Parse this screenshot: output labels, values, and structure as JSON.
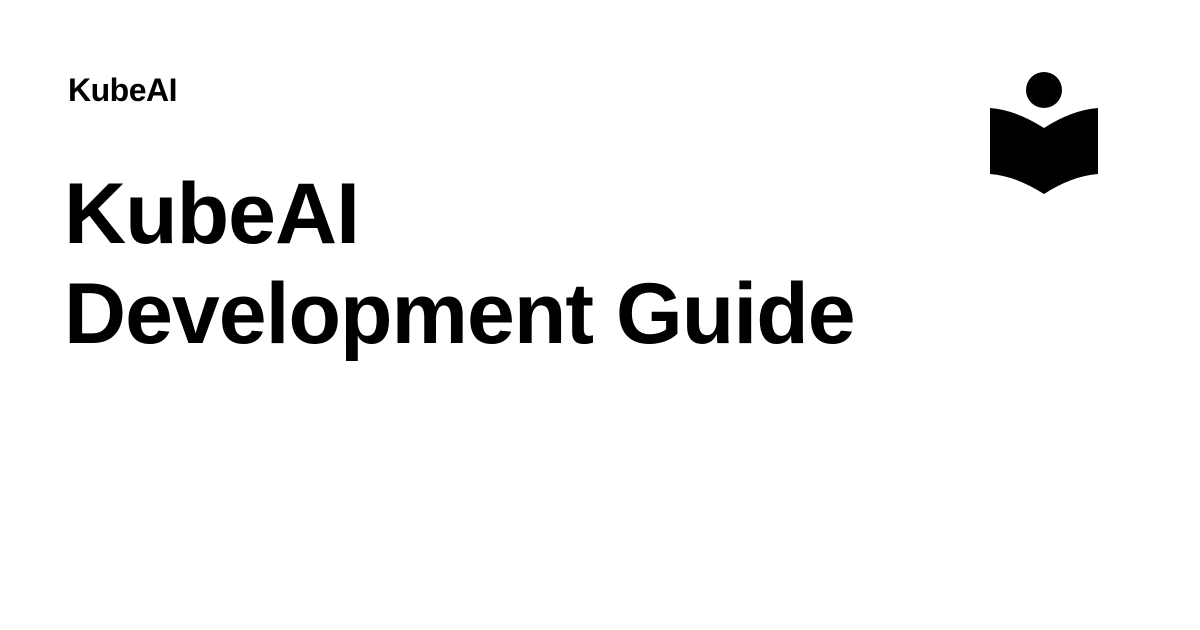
{
  "header": {
    "site_name": "KubeAI",
    "logo_icon": "open-book-reader-icon"
  },
  "main": {
    "title_line_1": "KubeAI",
    "title_line_2": "Development Guide"
  },
  "colors": {
    "background": "#ffffff",
    "text": "#000000"
  }
}
